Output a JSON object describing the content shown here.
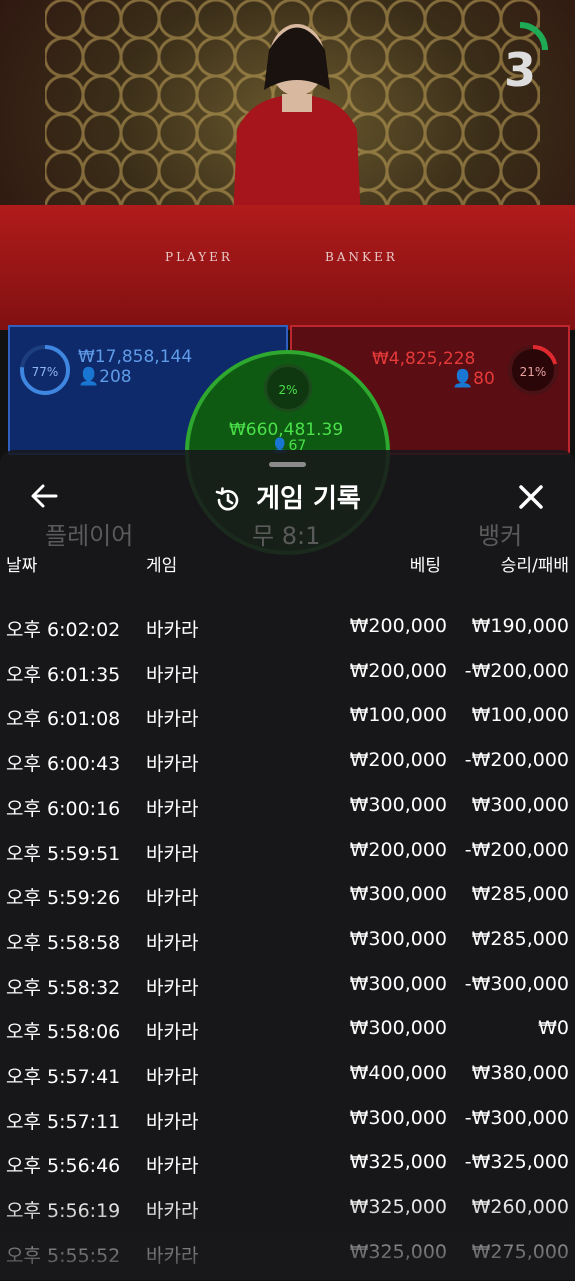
{
  "stream": {
    "countdown": "3",
    "player_label": "PLAYER",
    "banker_label": "BANKER"
  },
  "player_bets": {
    "percent": "77%",
    "amount": "₩17,858,144",
    "count": "208",
    "progress": 0.77
  },
  "banker_bets": {
    "percent": "21%",
    "amount": "₩4,825,228",
    "count": "80",
    "progress": 0.21
  },
  "tie_bets": {
    "percent": "2%",
    "amount": "₩660,481.39",
    "count": "67"
  },
  "background_labels": {
    "player": "플레이어",
    "tie": "무 8:1",
    "banker": "뱅커"
  },
  "history": {
    "title": "게임 기록",
    "columns": {
      "date": "날짜",
      "game": "게임",
      "bet": "베팅",
      "result": "승리/패배"
    },
    "rows": [
      {
        "time": "오후 6:02:02",
        "game": "바카라",
        "bet": "₩200,000",
        "result": "₩190,000"
      },
      {
        "time": "오후 6:01:35",
        "game": "바카라",
        "bet": "₩200,000",
        "result": "-₩200,000"
      },
      {
        "time": "오후 6:01:08",
        "game": "바카라",
        "bet": "₩100,000",
        "result": "₩100,000"
      },
      {
        "time": "오후 6:00:43",
        "game": "바카라",
        "bet": "₩200,000",
        "result": "-₩200,000"
      },
      {
        "time": "오후 6:00:16",
        "game": "바카라",
        "bet": "₩300,000",
        "result": "₩300,000"
      },
      {
        "time": "오후 5:59:51",
        "game": "바카라",
        "bet": "₩200,000",
        "result": "-₩200,000"
      },
      {
        "time": "오후 5:59:26",
        "game": "바카라",
        "bet": "₩300,000",
        "result": "₩285,000"
      },
      {
        "time": "오후 5:58:58",
        "game": "바카라",
        "bet": "₩300,000",
        "result": "₩285,000"
      },
      {
        "time": "오후 5:58:32",
        "game": "바카라",
        "bet": "₩300,000",
        "result": "-₩300,000"
      },
      {
        "time": "오후 5:58:06",
        "game": "바카라",
        "bet": "₩300,000",
        "result": "₩0"
      },
      {
        "time": "오후 5:57:41",
        "game": "바카라",
        "bet": "₩400,000",
        "result": "₩380,000"
      },
      {
        "time": "오후 5:57:11",
        "game": "바카라",
        "bet": "₩300,000",
        "result": "-₩300,000"
      },
      {
        "time": "오후 5:56:46",
        "game": "바카라",
        "bet": "₩325,000",
        "result": "-₩325,000"
      },
      {
        "time": "오후 5:56:19",
        "game": "바카라",
        "bet": "₩325,000",
        "result": "₩260,000"
      },
      {
        "time": "오후 5:55:52",
        "game": "바카라",
        "bet": "₩325,000",
        "result": "₩275,000"
      }
    ]
  },
  "colors": {
    "player": "#3f86e0",
    "banker": "#e02a30",
    "tie": "#3ad23a",
    "countdown_ring": "#1faa55"
  },
  "icons": {
    "back": "arrow-left-icon",
    "history": "history-clock-icon",
    "close": "close-icon"
  }
}
